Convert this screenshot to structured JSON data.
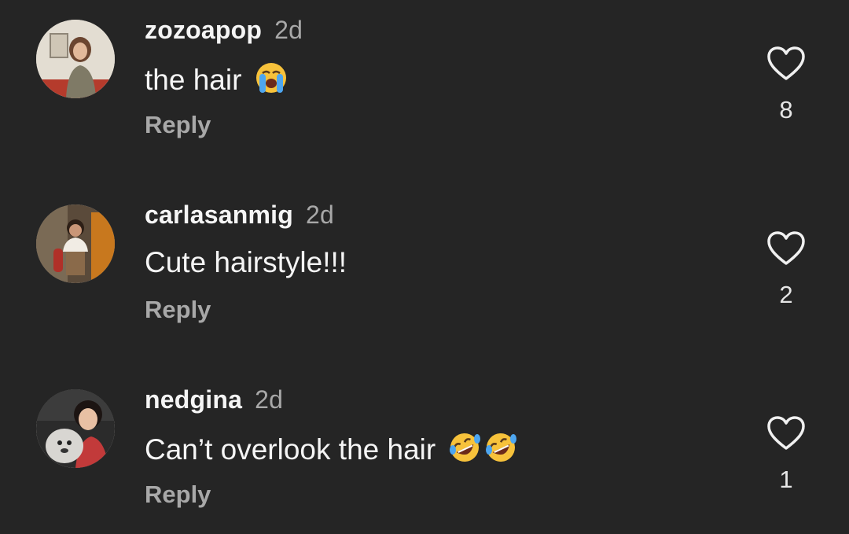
{
  "comments": [
    {
      "username": "zozoapop",
      "time": "2d",
      "text": "the hair",
      "emojis": [
        "loudly-crying-face"
      ],
      "reply_label": "Reply",
      "likes": "8"
    },
    {
      "username": "carlasanmig",
      "time": "2d",
      "text": "Cute hairstyle!!!",
      "emojis": [],
      "reply_label": "Reply",
      "likes": "2"
    },
    {
      "username": "nedgina",
      "time": "2d",
      "text": "Can’t overlook the hair",
      "emojis": [
        "rolling-on-the-floor-laughing",
        "rolling-on-the-floor-laughing"
      ],
      "reply_label": "Reply",
      "likes": "1"
    }
  ],
  "colors": {
    "background": "#252525",
    "primary_text": "#f5f5f5",
    "secondary_text": "#a8a8a8"
  }
}
